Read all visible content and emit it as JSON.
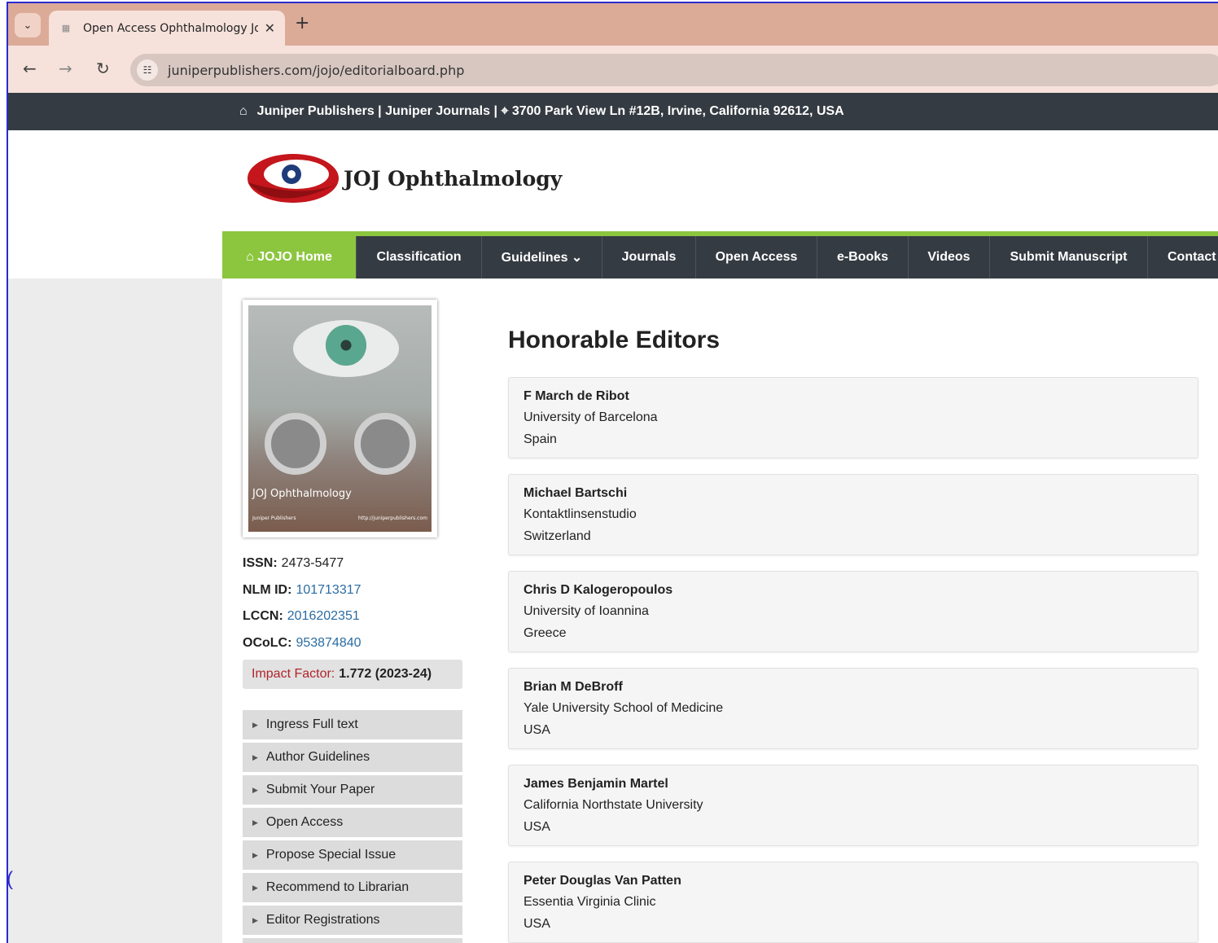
{
  "browser": {
    "tab_title": "Open Access Ophthalmology Jo",
    "url": "juniperpublishers.com/jojo/editorialboard.php"
  },
  "topstrip": {
    "text": "Juniper Publishers | Juniper Journals | ⌖ 3700 Park View Ln #12B, Irvine, California 92612, USA"
  },
  "logo": {
    "name": "JOJ Ophthalmology"
  },
  "menu": [
    {
      "label": "⌂ JOJO Home"
    },
    {
      "label": "Classification"
    },
    {
      "label": "Guidelines ⌄"
    },
    {
      "label": "Journals"
    },
    {
      "label": "Open Access"
    },
    {
      "label": "e-Books"
    },
    {
      "label": "Videos"
    },
    {
      "label": "Submit Manuscript"
    },
    {
      "label": "Contact"
    }
  ],
  "cover": {
    "title": "JOJ Ophthalmology",
    "footer_left": "Juniper Publishers",
    "footer_right": "http://juniperpublishers.com"
  },
  "ids": {
    "issn_label": "ISSN:",
    "issn": "2473-5477",
    "nlm_label": "NLM ID:",
    "nlm": "101713317",
    "lccn_label": "LCCN:",
    "lccn": "2016202351",
    "ocolc_label": "OCoLC:",
    "ocolc": "953874840"
  },
  "impact": {
    "label": "Impact Factor:",
    "value": "1.772 (2023-24)"
  },
  "sidelinks": [
    "Ingress Full text",
    "Author Guidelines",
    "Submit Your Paper",
    "Open Access",
    "Propose Special Issue",
    "Recommend to Librarian",
    "Editor Registrations"
  ],
  "heading": "Honorable Editors",
  "editors": [
    {
      "name": "F March de Ribot",
      "affiliation": "University of Barcelona",
      "country": "Spain"
    },
    {
      "name": "Michael Bartschi",
      "affiliation": "Kontaktlinsenstudio",
      "country": "Switzerland"
    },
    {
      "name": "Chris D Kalogeropoulos",
      "affiliation": "University of Ioannina",
      "country": "Greece"
    },
    {
      "name": "Brian M DeBroff",
      "affiliation": "Yale University School of Medicine",
      "country": "USA"
    },
    {
      "name": "James Benjamin Martel",
      "affiliation": "California Northstate University",
      "country": "USA"
    },
    {
      "name": "Peter Douglas Van Patten",
      "affiliation": "Essentia Virginia Clinic",
      "country": "USA"
    }
  ]
}
